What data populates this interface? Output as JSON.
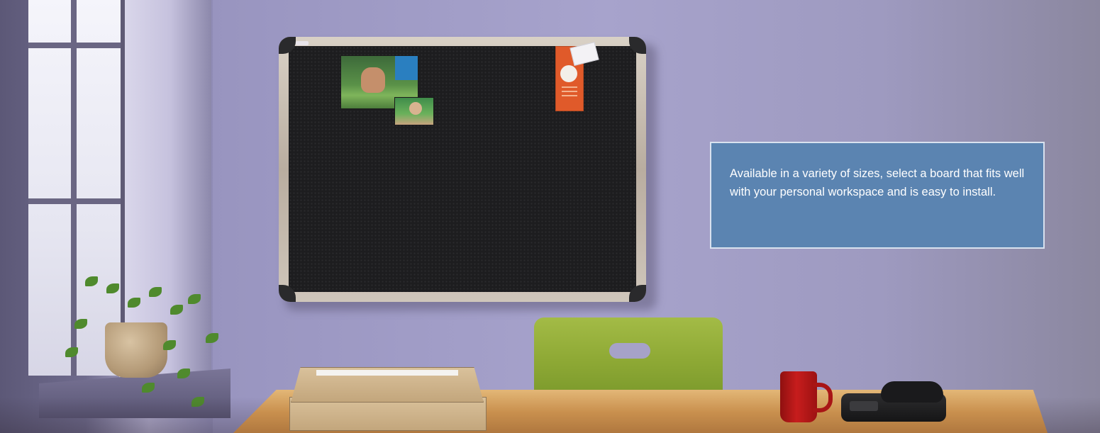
{
  "info_box": {
    "text": "Available in a variety of sizes, select a board that fits well with your personal workspace and is easy to install."
  },
  "colors": {
    "wall": "#a7a3cc",
    "info_box_bg": "#5b84b1",
    "info_box_border": "#d9e2ef",
    "board_surface": "#1d1d1f",
    "board_frame": "#c6bcb0",
    "chair": "#8ea935",
    "mug": "#c71d1d",
    "desk": "#c9904e"
  }
}
